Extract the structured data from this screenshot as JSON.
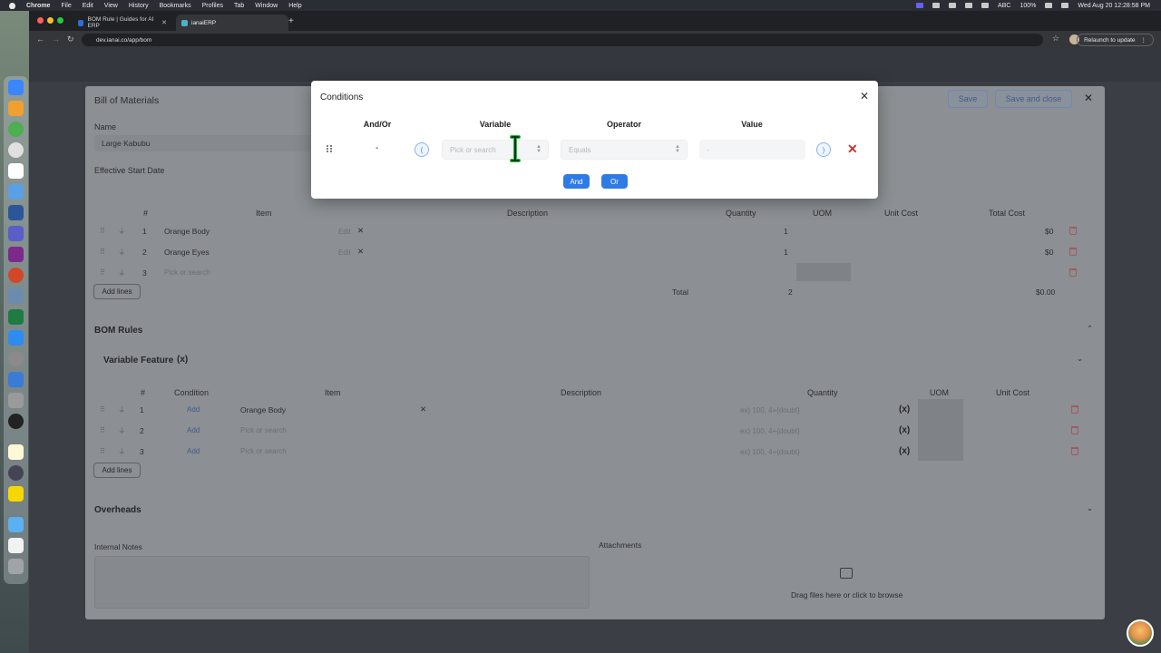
{
  "menubar": {
    "app": "Chrome",
    "items": [
      "File",
      "Edit",
      "View",
      "History",
      "Bookmarks",
      "Profiles",
      "Tab",
      "Window",
      "Help"
    ],
    "input_source": "ABC",
    "battery": "100%",
    "clock": "Wed Aug 20  12:28:58 PM"
  },
  "browser": {
    "tabs": [
      {
        "label": "BOM Rule | Guides for AI ERP"
      },
      {
        "label": "ianaiERP"
      }
    ],
    "url": "dev.ianai.co/app/bom",
    "relaunch_label": "Relaunch to update"
  },
  "bom": {
    "title": "Bill of Materials",
    "save_label": "Save",
    "save_close_label": "Save and close",
    "name_label": "Name",
    "name_value": "Large Kabubu",
    "start_date_label": "Effective Start Date",
    "items_table": {
      "headers": [
        "#",
        "Item",
        "Description",
        "Quantity",
        "UOM",
        "Unit Cost",
        "Total Cost"
      ],
      "rows": [
        {
          "num": "1",
          "item": "Orange Body",
          "edit": "Edit",
          "qty": "1",
          "total": "$0"
        },
        {
          "num": "2",
          "item": "Orange Eyes",
          "edit": "Edit",
          "qty": "1",
          "total": "$0"
        },
        {
          "num": "3",
          "item_placeholder": "Pick or search"
        }
      ],
      "add_lines": "Add lines",
      "total_label": "Total",
      "total_qty": "2",
      "total_cost": "$0.00"
    },
    "rules": {
      "title": "BOM Rules",
      "variable_feature": "Variable Feature",
      "variable_feature_icon": "(x)",
      "headers": [
        "#",
        "Condition",
        "Item",
        "Description",
        "Quantity",
        "UOM",
        "Unit Cost"
      ],
      "rows": [
        {
          "num": "1",
          "condition": "Add",
          "item": "Orange Body",
          "qty_placeholder": "ex) 100, 4+{doubt}"
        },
        {
          "num": "2",
          "condition": "Add",
          "item_placeholder": "Pick or search",
          "qty_placeholder": "ex) 100, 4+{doubt}"
        },
        {
          "num": "3",
          "condition": "Add",
          "item_placeholder": "Pick or search",
          "qty_placeholder": "ex) 100, 4+{doubt}"
        }
      ],
      "add_lines": "Add lines"
    },
    "overheads_title": "Overheads",
    "internal_notes_label": "Internal Notes",
    "attachments_label": "Attachments",
    "drop_text": "Drag files here or click to browse"
  },
  "modal": {
    "title": "Conditions",
    "columns": {
      "and_or": "And/Or",
      "variable": "Variable",
      "operator": "Operator",
      "value": "Value"
    },
    "row": {
      "and_or": "-",
      "open_paren": "(",
      "variable_placeholder": "Pick or search",
      "operator_placeholder": "Equals",
      "value_placeholder": "-",
      "close_paren": ")"
    },
    "and_label": "And",
    "or_label": "Or"
  },
  "colors": {
    "accent": "#2f7be6",
    "danger": "#d32f2f",
    "cursor_glow": "#1fbf3a"
  }
}
